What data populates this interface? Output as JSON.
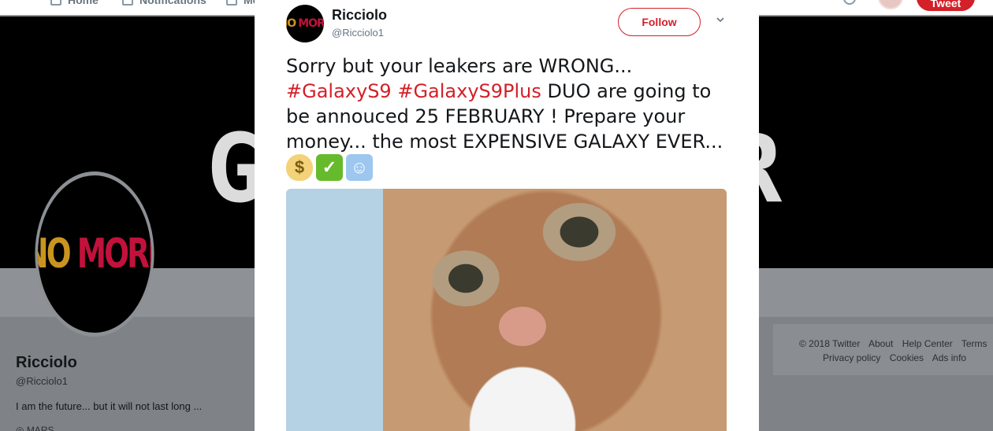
{
  "topnav": {
    "home_label": "Home",
    "notifications_label": "Notifications",
    "messages_label": "Messages",
    "tweet_button": "Tweet"
  },
  "banner": {
    "left_text": "G",
    "right_text": "R"
  },
  "profile": {
    "avatar_text_1": "NO",
    "avatar_text_2": "MORE",
    "name": "Ricciolo",
    "handle": "@Ricciolo1",
    "bio": "I am the future... but it will not last long ...",
    "location": "MARS"
  },
  "footer": {
    "row1": [
      "© 2018 Twitter",
      "About",
      "Help Center",
      "Terms"
    ],
    "row2": [
      "Privacy policy",
      "Cookies",
      "Ads info"
    ]
  },
  "modal": {
    "avatar_text_1": "NO",
    "avatar_text_2": "MORE",
    "name": "Ricciolo",
    "handle": "@Ricciolo1",
    "follow_label": "Follow",
    "text_1": "Sorry but your leakers are WRONG...",
    "hashtag_1": "#GalaxyS9",
    "hashtag_2": "#GalaxyS9Plus",
    "text_2": "DUO are going to be annouced 25 FEBRUARY ! Prepare your money... the most EXPENSIVE GALAXY EVER...",
    "emojis": [
      "money-bag",
      "check-mark",
      "mage"
    ],
    "media": "kitten-gif"
  },
  "colors": {
    "accent": "#d32029",
    "text": "#14171a",
    "secondary_text": "#657786"
  }
}
